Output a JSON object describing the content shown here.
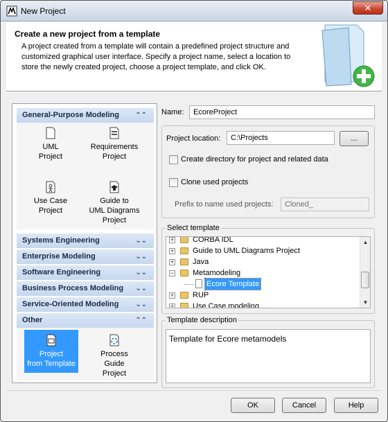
{
  "window": {
    "title": "New Project",
    "close_glyph": "✕"
  },
  "header": {
    "title": "Create a new project from a template",
    "description": "A project created from a template will contain a predefined project structure and customized graphical user interface. Specify a project name, select a location to store the newly created project, choose a project template, and click OK."
  },
  "categories": [
    {
      "label": "General-Purpose Modeling",
      "expanded": true
    },
    {
      "label": "Systems Engineering",
      "expanded": false
    },
    {
      "label": "Enterprise Modeling",
      "expanded": false
    },
    {
      "label": "Software Engineering",
      "expanded": false
    },
    {
      "label": "Business Process Modeling",
      "expanded": false
    },
    {
      "label": "Service-Oriented Modeling",
      "expanded": false
    },
    {
      "label": "Other",
      "expanded": true
    }
  ],
  "general_tiles": [
    {
      "label": "UML\nProject",
      "icon": "uml-document-icon"
    },
    {
      "label": "Requirements\nProject",
      "icon": "requirements-icon"
    },
    {
      "label": "Use Case\nProject",
      "icon": "use-case-icon"
    },
    {
      "label": "Guide to\nUML Diagrams\nProject",
      "icon": "graduation-cap-icon"
    }
  ],
  "other_tiles": [
    {
      "label": "Project\nfrom Template",
      "icon": "template-icon",
      "selected": true
    },
    {
      "label": "Process\nGuide\nProject",
      "icon": "process-guide-icon",
      "selected": false
    }
  ],
  "form": {
    "name_label": "Name:",
    "name_value": "EcoreProject",
    "location_label": "Project location:",
    "location_value": "C:\\Projects",
    "browse_label": "...",
    "create_dir_label": "Create directory for project and related data",
    "create_dir_checked": false,
    "clone_label": "Clone used projects",
    "clone_checked": false,
    "prefix_label": "Prefix to name used projects:",
    "prefix_value": "Cloned_"
  },
  "template": {
    "legend": "Select template",
    "rows": [
      {
        "label": "CORBA IDL",
        "expander": "+",
        "indent": 0,
        "kind": "folder"
      },
      {
        "label": "Guide to UML Diagrams Project",
        "expander": "+",
        "indent": 0,
        "kind": "folder"
      },
      {
        "label": "Java",
        "expander": "+",
        "indent": 0,
        "kind": "folder"
      },
      {
        "label": "Metamodeling",
        "expander": "−",
        "indent": 0,
        "kind": "folder"
      },
      {
        "label": "Ecore Template",
        "expander": "",
        "indent": 1,
        "kind": "doc",
        "selected": true
      },
      {
        "label": "RUP",
        "expander": "+",
        "indent": 0,
        "kind": "folder"
      },
      {
        "label": "Use Case modeling",
        "expander": "+",
        "indent": 0,
        "kind": "folder"
      }
    ],
    "description_legend": "Template description",
    "description": "Template for Ecore metamodels"
  },
  "buttons": {
    "ok": "OK",
    "cancel": "Cancel",
    "help": "Help"
  },
  "colors": {
    "selection": "#3399ff",
    "category_bg": "#c6d7ee"
  }
}
